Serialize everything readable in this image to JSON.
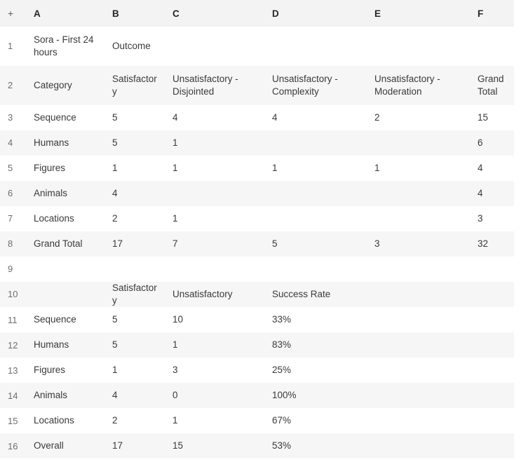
{
  "sheet": {
    "corner_label": "+",
    "column_headers": [
      "A",
      "B",
      "C",
      "D",
      "E",
      "F"
    ],
    "row_numbers": [
      "1",
      "2",
      "3",
      "4",
      "5",
      "6",
      "7",
      "8",
      "9",
      "10",
      "11",
      "12",
      "13",
      "14",
      "15",
      "16"
    ],
    "colors": {
      "header_band": "#f3f3f3",
      "row_alt": "#f6f6f6",
      "row_base": "#ffffff",
      "text": "#3a3a3a",
      "header_text": "#22272b",
      "rownum_text": "#6a6f75"
    },
    "rows": [
      {
        "n": "1",
        "height": "tall",
        "shaded": false,
        "cells": [
          "Sora - First 24 hours",
          "Outcome",
          "",
          "",
          "",
          ""
        ]
      },
      {
        "n": "2",
        "height": "tall",
        "shaded": true,
        "cells": [
          "Category",
          "Satisfactory",
          "Unsatisfactory - Disjointed",
          "Unsatisfactory - Complexity",
          "Unsatisfactory - Moderation",
          "Grand Total"
        ]
      },
      {
        "n": "3",
        "height": "std",
        "shaded": false,
        "cells": [
          "Sequence",
          "5",
          "4",
          "4",
          "2",
          "15"
        ]
      },
      {
        "n": "4",
        "height": "std",
        "shaded": true,
        "cells": [
          "Humans",
          "5",
          "1",
          "",
          "",
          "6"
        ]
      },
      {
        "n": "5",
        "height": "std",
        "shaded": false,
        "cells": [
          "Figures",
          "1",
          "1",
          "1",
          "1",
          "4"
        ]
      },
      {
        "n": "6",
        "height": "std",
        "shaded": true,
        "cells": [
          "Animals",
          "4",
          "",
          "",
          "",
          "4"
        ]
      },
      {
        "n": "7",
        "height": "std",
        "shaded": false,
        "cells": [
          "Locations",
          "2",
          "1",
          "",
          "",
          "3"
        ]
      },
      {
        "n": "8",
        "height": "std",
        "shaded": true,
        "cells": [
          "Grand Total",
          "17",
          "7",
          "5",
          "3",
          "32"
        ]
      },
      {
        "n": "9",
        "height": "std",
        "shaded": false,
        "cells": [
          "",
          "",
          "",
          "",
          "",
          ""
        ]
      },
      {
        "n": "10",
        "height": "std",
        "shaded": true,
        "cells": [
          "",
          "Satisfactory",
          "Unsatisfactory",
          "Success Rate",
          "",
          ""
        ]
      },
      {
        "n": "11",
        "height": "std",
        "shaded": false,
        "cells": [
          "Sequence",
          "5",
          "10",
          "33%",
          "",
          ""
        ]
      },
      {
        "n": "12",
        "height": "std",
        "shaded": true,
        "cells": [
          "Humans",
          "5",
          "1",
          "83%",
          "",
          ""
        ]
      },
      {
        "n": "13",
        "height": "std",
        "shaded": false,
        "cells": [
          "Figures",
          "1",
          "3",
          "25%",
          "",
          ""
        ]
      },
      {
        "n": "14",
        "height": "std",
        "shaded": true,
        "cells": [
          "Animals",
          "4",
          "0",
          "100%",
          "",
          ""
        ]
      },
      {
        "n": "15",
        "height": "std",
        "shaded": false,
        "cells": [
          "Locations",
          "2",
          "1",
          "67%",
          "",
          ""
        ]
      },
      {
        "n": "16",
        "height": "std",
        "shaded": true,
        "cells": [
          "Overall",
          "17",
          "15",
          "53%",
          "",
          ""
        ]
      }
    ]
  }
}
